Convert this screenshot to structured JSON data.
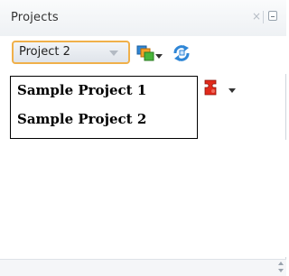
{
  "panel": {
    "title": "Projects",
    "close_glyph": "×"
  },
  "toolbar": {
    "project_selector": {
      "selected": "Project 2"
    },
    "icons": [
      "copy-projects-icon",
      "dropdown-arrow-icon",
      "sync-icon",
      "component-icon",
      "dropdown-arrow-icon"
    ]
  },
  "dropdown": {
    "items": [
      {
        "label": "Sample Project 1"
      },
      {
        "label": "Sample Project 2"
      }
    ]
  },
  "colors": {
    "selector_border": "#f0b04a",
    "menu_border": "#000000",
    "icon_blue": "#2f86d6",
    "icon_red": "#e02a1b",
    "icon_green": "#48b53a",
    "icon_orange": "#f3a12a"
  }
}
